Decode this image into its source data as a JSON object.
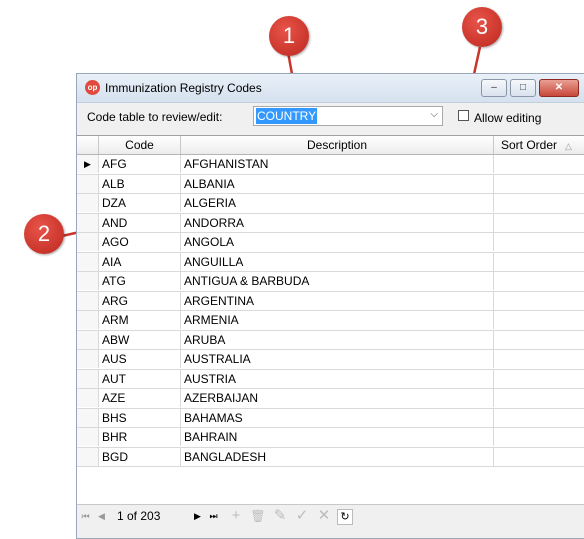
{
  "window": {
    "title": "Immunization Registry Codes",
    "app_icon_text": "op",
    "controls": {
      "minimize": "–",
      "maximize": "□",
      "close": "✕"
    }
  },
  "toolbar": {
    "label": "Code table to review/edit:",
    "code_table_value": "COUNTRY",
    "dropdown_arrow": "⌵",
    "allow_editing_label": "Allow editing",
    "allow_editing_checked": false
  },
  "grid": {
    "columns": {
      "code": "Code",
      "description": "Description",
      "sort_order": "Sort Order"
    },
    "sort_glyph": "△",
    "current_row_marker": "▶",
    "rows": [
      {
        "code": "AFG",
        "description": "AFGHANISTAN",
        "sort_order": ""
      },
      {
        "code": "ALB",
        "description": "ALBANIA",
        "sort_order": ""
      },
      {
        "code": "DZA",
        "description": "ALGERIA",
        "sort_order": ""
      },
      {
        "code": "AND",
        "description": "ANDORRA",
        "sort_order": ""
      },
      {
        "code": "AGO",
        "description": "ANGOLA",
        "sort_order": ""
      },
      {
        "code": "AIA",
        "description": "ANGUILLA",
        "sort_order": ""
      },
      {
        "code": "ATG",
        "description": "ANTIGUA & BARBUDA",
        "sort_order": ""
      },
      {
        "code": "ARG",
        "description": "ARGENTINA",
        "sort_order": ""
      },
      {
        "code": "ARM",
        "description": "ARMENIA",
        "sort_order": ""
      },
      {
        "code": "ABW",
        "description": "ARUBA",
        "sort_order": ""
      },
      {
        "code": "AUS",
        "description": "AUSTRALIA",
        "sort_order": ""
      },
      {
        "code": "AUT",
        "description": "AUSTRIA",
        "sort_order": ""
      },
      {
        "code": "AZE",
        "description": "AZERBAIJAN",
        "sort_order": ""
      },
      {
        "code": "BHS",
        "description": "BAHAMAS",
        "sort_order": ""
      },
      {
        "code": "BHR",
        "description": "BAHRAIN",
        "sort_order": ""
      },
      {
        "code": "BGD",
        "description": "BANGLADESH",
        "sort_order": ""
      }
    ]
  },
  "navigator": {
    "first": "⏮",
    "prev": "◀",
    "position": "1 of 203",
    "next": "▶",
    "last": "⏭",
    "add": "+",
    "delete": "🗑",
    "edit": "✎",
    "post": "✓",
    "cancel": "✕",
    "refresh": "↻"
  },
  "callouts": [
    "1",
    "2",
    "3"
  ],
  "colors": {
    "callout": "#c9342b",
    "selection": "#3399ff",
    "window_border": "#9aa7b8"
  }
}
